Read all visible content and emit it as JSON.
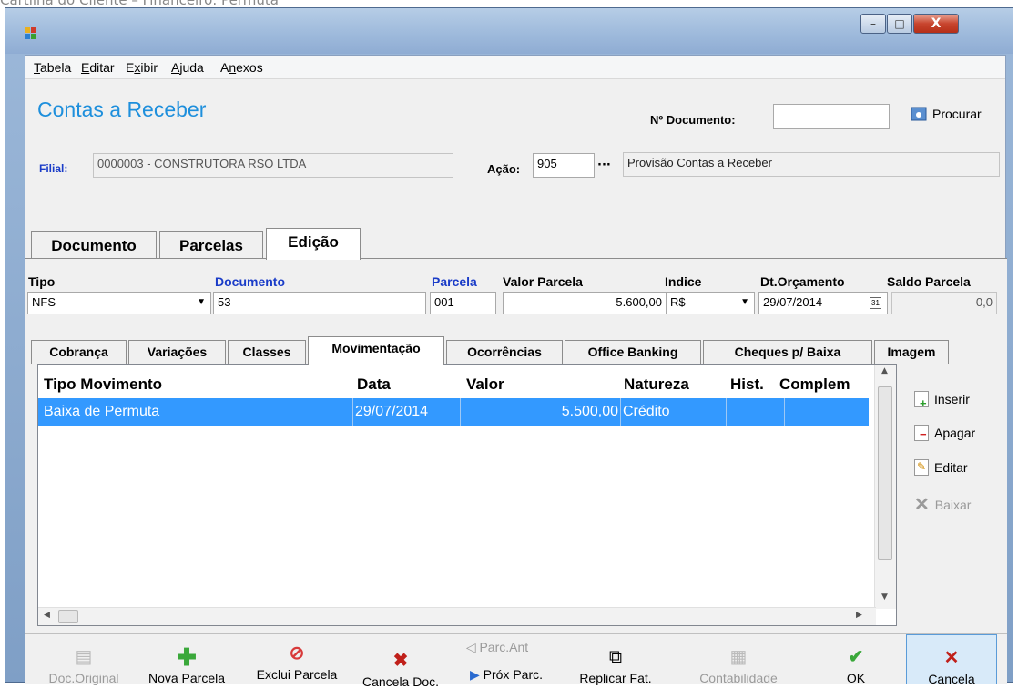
{
  "caption": "Cartilha do Cliente – Financeiro: Permuta",
  "window": {
    "min": "–",
    "max": "□",
    "close": "X"
  },
  "menu": [
    {
      "first": "T",
      "rest": "abela"
    },
    {
      "first": "E",
      "rest": "ditar"
    },
    {
      "first": "",
      "pre": "E",
      "u": "x",
      "rest": "ibir"
    },
    {
      "first": "A",
      "rest": "juda"
    },
    {
      "first": "",
      "pre": "A",
      "u": "n",
      "rest": "exos"
    }
  ],
  "page_title": "Contas a Receber",
  "doc_label": "Nº Documento:",
  "doc_value": "",
  "search_label": "Procurar",
  "filial_label": "Filial:",
  "filial_value": "0000003 - CONSTRUTORA RSO LTDA",
  "acao_label": "Ação:",
  "acao_code": "905",
  "acao_dots": "···",
  "acao_desc": "Provisão Contas a Receber",
  "main_tabs": [
    "Documento",
    "Parcelas",
    "Edição"
  ],
  "fields": {
    "tipo_label": "Tipo",
    "tipo_value": "NFS",
    "documento_label": "Documento",
    "documento_value": "53",
    "parcela_label": "Parcela",
    "parcela_value": "001",
    "valor_label": "Valor Parcela",
    "valor_value": "5.600,00",
    "indice_label": "Indice",
    "indice_value": "R$",
    "dt_label": "Dt.Orçamento",
    "dt_value": "29/07/2014",
    "saldo_label": "Saldo Parcela",
    "saldo_value": "0,0"
  },
  "sub_tabs": [
    "Cobrança",
    "Variações",
    "Classes",
    "Movimentação",
    "Ocorrências",
    "Office Banking",
    "Cheques p/ Baixa",
    "Imagem"
  ],
  "grid": {
    "columns": [
      "Tipo Movimento",
      "Data",
      "Valor",
      "Natureza",
      "Hist.",
      "Complem"
    ],
    "rows": [
      [
        "Baixa de Permuta",
        "29/07/2014",
        "5.500,00",
        "Crédito",
        "",
        ""
      ]
    ]
  },
  "side_buttons": {
    "inserir": "Inserir",
    "apagar": "Apagar",
    "editar": "Editar",
    "baixar": "Baixar"
  },
  "bottom_buttons": {
    "doc_original": "Doc.Original",
    "nova_parcela": "Nova Parcela",
    "exclui_parcela": "Exclui Parcela",
    "cancela_doc": "Cancela Doc.",
    "parc_ant": "Parc.Ant",
    "prox_parc": "Próx Parc.",
    "replicar_fat": "Replicar Fat.",
    "contabilidade": "Contabilidade",
    "ok": "OK",
    "cancela": "Cancela"
  }
}
